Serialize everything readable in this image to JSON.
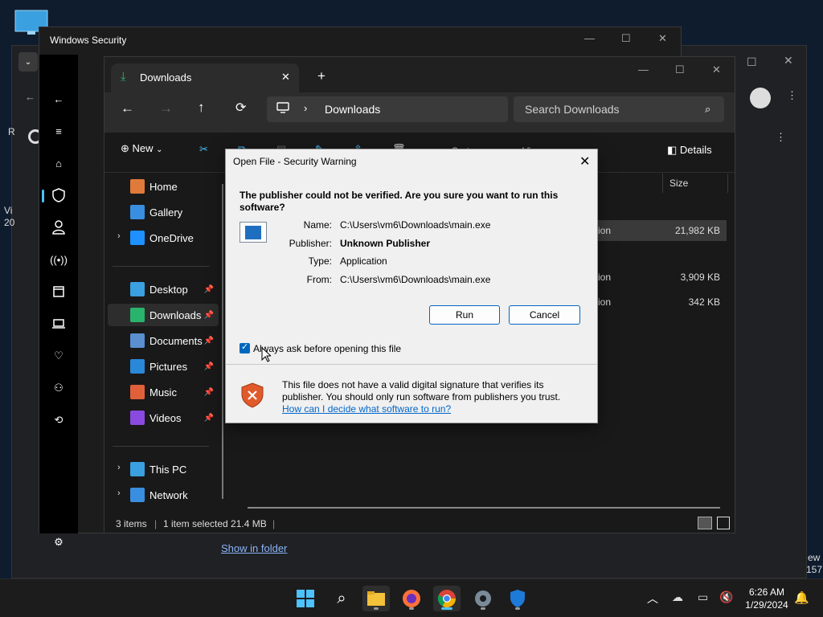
{
  "background_window": {
    "left_labels": [
      "R",
      "Vi",
      "20"
    ],
    "right_labels": [
      "ew",
      "157"
    ],
    "show_in_folder": "Show in folder"
  },
  "windows_security": {
    "title": "Windows Security",
    "rail_icons": [
      "back-arrow-icon",
      "hamburger-icon",
      "home-icon",
      "shield-icon",
      "person-icon",
      "wireless-icon",
      "app-browser-icon",
      "laptop-icon",
      "heart-pulse-icon",
      "family-icon",
      "history-icon",
      "settings-icon"
    ],
    "selected_item": "shield-icon"
  },
  "explorer": {
    "tab_title": "Downloads",
    "address": "Downloads",
    "search_placeholder": "Search Downloads",
    "new_label": "New",
    "details_label": "Details",
    "faded_toolbar_labels": [
      "Sort",
      "View"
    ],
    "nav": [
      {
        "label": "Home",
        "color": "#e07a3a"
      },
      {
        "label": "Gallery",
        "color": "#3a8ee0"
      },
      {
        "label": "OneDrive",
        "color": "#1e90ff"
      },
      {
        "label": "Desktop",
        "color": "#3aa0e0"
      },
      {
        "label": "Downloads",
        "color": "#2ab36c"
      },
      {
        "label": "Documents",
        "color": "#5a8fd0"
      },
      {
        "label": "Pictures",
        "color": "#2a88d8"
      },
      {
        "label": "Music",
        "color": "#e0603a"
      },
      {
        "label": "Videos",
        "color": "#8a4ae0"
      },
      {
        "label": "This PC",
        "color": "#3aa0e0"
      },
      {
        "label": "Network",
        "color": "#3a8ee0"
      }
    ],
    "pin_icon": "pin-icon",
    "column_header_size": "Size",
    "rows": [
      {
        "type": "ation",
        "size": "21,982 KB",
        "selected": true
      },
      {
        "type": "ation",
        "size": "3,909 KB",
        "selected": false
      },
      {
        "type": "ation",
        "size": "342 KB",
        "selected": false
      }
    ],
    "status": {
      "count": "3 items",
      "selected": "1 item selected  21.4 MB"
    }
  },
  "dialog": {
    "title": "Open File - Security Warning",
    "headline": "The publisher could not be verified.  Are you sure you want to run this software?",
    "fields": [
      {
        "key": "Name:",
        "value": "C:\\Users\\vm6\\Downloads\\main.exe",
        "bold": false
      },
      {
        "key": "Publisher:",
        "value": "Unknown Publisher",
        "bold": true
      },
      {
        "key": "Type:",
        "value": "Application",
        "bold": false
      },
      {
        "key": "From:",
        "value": "C:\\Users\\vm6\\Downloads\\main.exe",
        "bold": false
      }
    ],
    "run_label": "Run",
    "cancel_label": "Cancel",
    "checkbox_label": "Always ask before opening this file",
    "checkbox_checked": true,
    "warning_text": "This file does not have a valid digital signature that verifies its publisher.  You should only run software from publishers you trust.",
    "help_link": "How can I decide what software to run?"
  },
  "taskbar": {
    "icons": [
      "windows-start-icon",
      "search-icon",
      "file-explorer-icon",
      "firefox-icon",
      "chrome-icon",
      "settings-icon",
      "windows-security-icon"
    ],
    "active": "chrome-icon",
    "time": "6:26 AM",
    "date": "1/29/2024"
  }
}
